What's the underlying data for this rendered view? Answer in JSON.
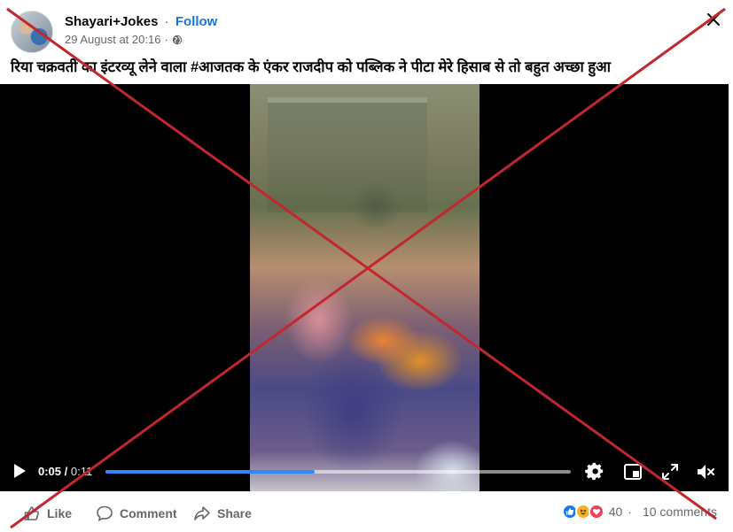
{
  "post": {
    "page_name": "Shayari+Jokes",
    "separator": "·",
    "follow_label": "Follow",
    "timestamp": "29 August at 20:16",
    "meta_separator": "·",
    "privacy_icon": "globe-icon",
    "caption": "रिया चक्रवर्ती का इंटरव्यू लेने वाला #आजतक के एंकर राजदीप को पब्लिक ने पीटा मेरे हिसाब से तो बहुत अच्छा हुआ"
  },
  "video": {
    "current_time": "0:05",
    "time_separator": " / ",
    "total_time": "0:11",
    "progress_fraction": 0.45
  },
  "footer": {
    "like_label": "Like",
    "comment_label": "Comment",
    "share_label": "Share",
    "reaction_count": "40",
    "dot": "·",
    "comments_count": "10 comments"
  },
  "colors": {
    "link_blue": "#1b74e4",
    "progress_blue": "#2d88ff",
    "overlay_red": "#c1272d",
    "like_blue": "#1877f2",
    "love_red": "#f33e58",
    "haha_yellow": "#f7b125"
  }
}
